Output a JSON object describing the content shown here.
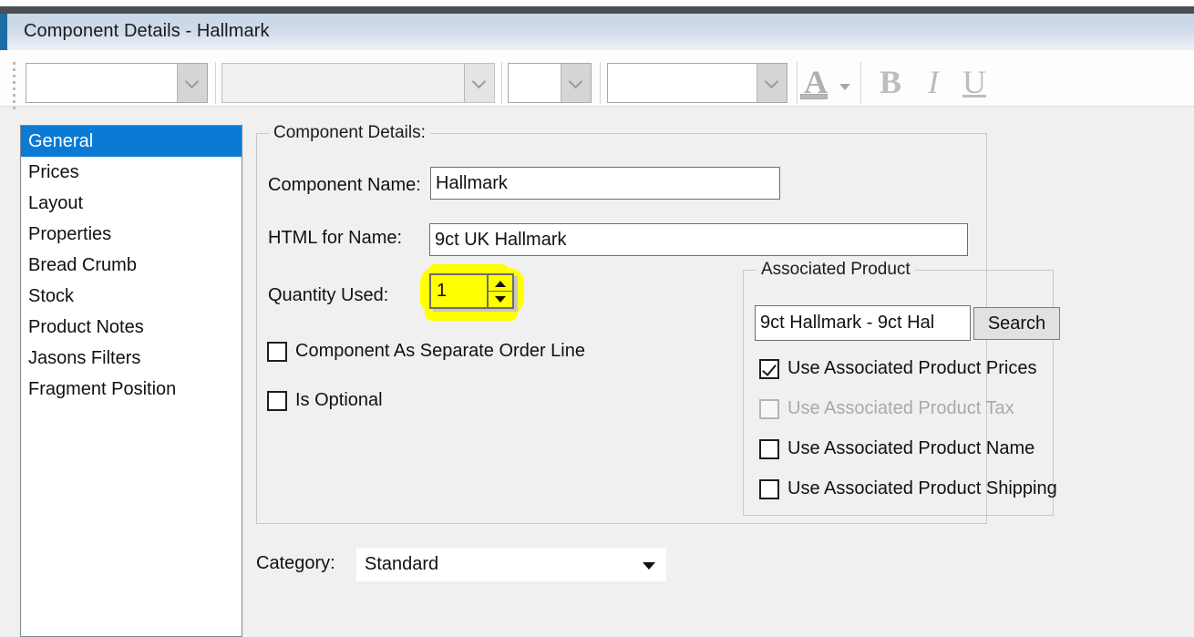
{
  "window": {
    "title": "Component Details - Hallmark"
  },
  "toolbar": {
    "font_name_value": "",
    "font_name2_value": "",
    "font_size_value": "",
    "style_value": "",
    "font_color_label": "A",
    "bold_label": "B",
    "italic_label": "I",
    "underline_label": "U"
  },
  "sidebar": {
    "items": [
      {
        "label": "General",
        "selected": true
      },
      {
        "label": "Prices",
        "selected": false
      },
      {
        "label": "Layout",
        "selected": false
      },
      {
        "label": "Properties",
        "selected": false
      },
      {
        "label": "Bread Crumb",
        "selected": false
      },
      {
        "label": "Stock",
        "selected": false
      },
      {
        "label": "Product Notes",
        "selected": false
      },
      {
        "label": "Jasons Filters",
        "selected": false
      },
      {
        "label": "Fragment Position",
        "selected": false
      }
    ]
  },
  "component_details": {
    "legend": "Component Details:",
    "component_name_label": "Component Name:",
    "component_name_value": "Hallmark",
    "html_for_name_label": "HTML for Name:",
    "html_for_name_value": "9ct UK Hallmark",
    "quantity_used_label": "Quantity Used:",
    "quantity_used_value": "1",
    "separate_order_line_label": "Component As Separate Order Line",
    "separate_order_line_checked": false,
    "is_optional_label": "Is Optional",
    "is_optional_checked": false
  },
  "associated_product": {
    "legend": "Associated Product",
    "search_value": "9ct Hallmark -    9ct Hal",
    "search_button_label": "Search",
    "checkboxes": [
      {
        "label": "Use Associated Product Prices",
        "checked": true,
        "disabled": false
      },
      {
        "label": "Use Associated Product Tax",
        "checked": false,
        "disabled": true
      },
      {
        "label": "Use Associated Product Name",
        "checked": false,
        "disabled": false
      },
      {
        "label": "Use Associated Product Shipping",
        "checked": false,
        "disabled": false
      }
    ]
  },
  "category": {
    "label": "Category:",
    "value": "Standard"
  },
  "annotation": {
    "highlight_color": "#ffff00",
    "highlight_target": "quantity-used-spinner"
  }
}
